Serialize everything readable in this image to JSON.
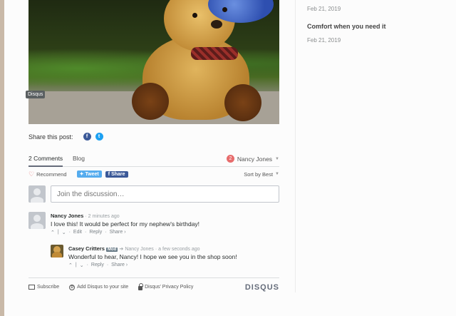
{
  "image": {
    "tag": "Disqus"
  },
  "share": {
    "label": "Share this post:",
    "fb_glyph": "f",
    "tw_glyph": "t"
  },
  "sidebar": {
    "date1": "Feb 21, 2019",
    "post_title": "Comfort when you need it",
    "date2": "Feb 21, 2019"
  },
  "tabs": {
    "comments": "2 Comments",
    "blog": "Blog",
    "user_name": "Nancy Jones",
    "notif_count": "2"
  },
  "actions": {
    "recommend": "Recommend",
    "tweet": "Tweet",
    "share": "Share",
    "sort": "Sort by Best"
  },
  "composer": {
    "placeholder": "Join the discussion…"
  },
  "comments": [
    {
      "author": "Nancy Jones",
      "time": "· 2 minutes ago",
      "text": "I love this! It would be perfect for my nephew's birthday!",
      "edit": "Edit",
      "reply": "Reply",
      "share": "Share ›"
    },
    {
      "author": "Casey Critters",
      "badge": "Mod",
      "reply_to": "Nancy Jones",
      "time": "· a few seconds ago",
      "text": "Wonderful to hear, Nancy! I hope we see you in the shop soon!",
      "reply": "Reply",
      "share": "Share ›"
    }
  ],
  "footer": {
    "subscribe": "Subscribe",
    "add": "Add Disqus to your site",
    "privacy": "Disqus' Privacy Policy",
    "logo": "DISQUS"
  },
  "colors": {
    "accent_red": "#e76c6c",
    "facebook": "#3b5998",
    "twitter": "#55acee"
  }
}
